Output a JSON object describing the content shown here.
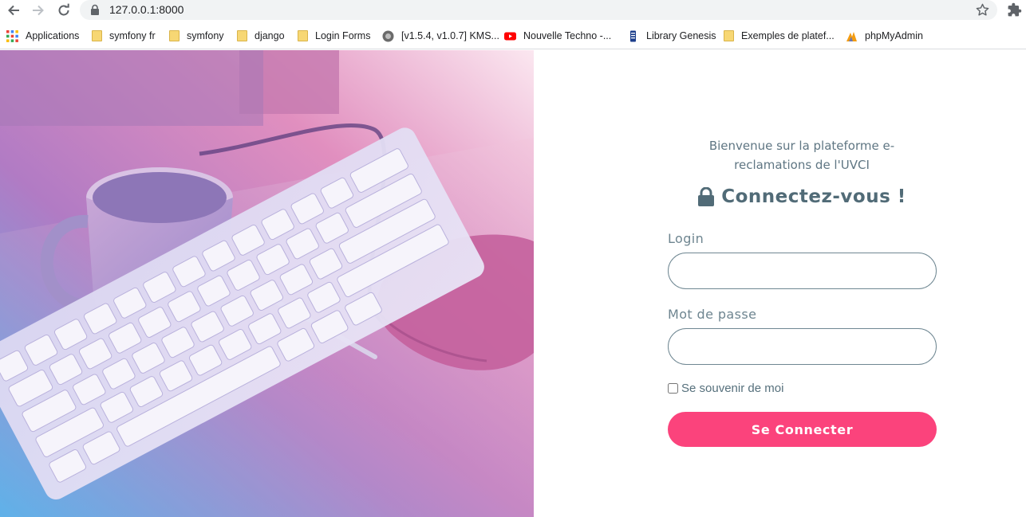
{
  "browser": {
    "url": "127.0.0.1:8000",
    "bookmarks": [
      {
        "label": "Applications",
        "icon": "apps-grid-icon"
      },
      {
        "label": "symfony fr",
        "icon": "folder-icon"
      },
      {
        "label": "symfony",
        "icon": "folder-icon"
      },
      {
        "label": "django",
        "icon": "folder-icon"
      },
      {
        "label": "Login Forms",
        "icon": "folder-icon"
      },
      {
        "label": "[v1.5.4, v1.0.7] KMS...",
        "icon": "site-favicon"
      },
      {
        "label": "Nouvelle Techno -...",
        "icon": "youtube-icon"
      },
      {
        "label": "Library Genesis",
        "icon": "library-favicon"
      },
      {
        "label": "Exemples de platef...",
        "icon": "folder-icon"
      },
      {
        "label": "phpMyAdmin",
        "icon": "phpmyadmin-icon"
      }
    ]
  },
  "login": {
    "welcome": "Bienvenue sur la plateforme e-reclamations de l'UVCI",
    "title": "Connectez-vous !",
    "login_label": "Login",
    "login_value": "",
    "password_label": "Mot de passe",
    "password_value": "",
    "remember_label": "Se souvenir de moi",
    "remember_checked": false,
    "submit_label": "Se Connecter"
  },
  "colors": {
    "accent": "#fb437c",
    "text": "#516b77",
    "hero_gradient": [
      "#e779b4",
      "#b47bc6",
      "#58b6ec"
    ]
  }
}
